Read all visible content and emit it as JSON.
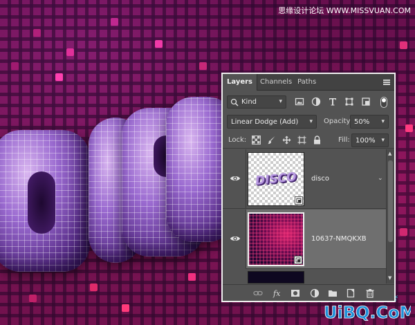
{
  "watermark": {
    "top_text": "思缘设计论坛 WWW.MISSVUAN.COM",
    "logo_small": "PS 爱好者",
    "logo_big": "UiBQ.CoM"
  },
  "panel": {
    "tabs": [
      {
        "label": "Layers",
        "active": true
      },
      {
        "label": "Channels",
        "active": false
      },
      {
        "label": "Paths",
        "active": false
      }
    ],
    "filter": {
      "kind_label": "Kind",
      "icons": [
        "image-filter-icon",
        "adjustment-filter-icon",
        "type-filter-icon",
        "shape-filter-icon",
        "smart-object-filter-icon"
      ]
    },
    "blend_mode": "Linear Dodge (Add)",
    "opacity_label": "Opacity:",
    "opacity_value": "50%",
    "lock_label": "Lock:",
    "fill_label": "Fill:",
    "fill_value": "100%",
    "layers": [
      {
        "name": "disco",
        "thumb_text": "DISCO",
        "selected": false
      },
      {
        "name": "10637-NMQKXB",
        "selected": true
      }
    ]
  },
  "colors": {
    "panel_bg": "#535353",
    "selected_layer": "#6f6f6f",
    "artwork_pink": "#d0206a",
    "letter_purple": "#9a6ad0"
  }
}
